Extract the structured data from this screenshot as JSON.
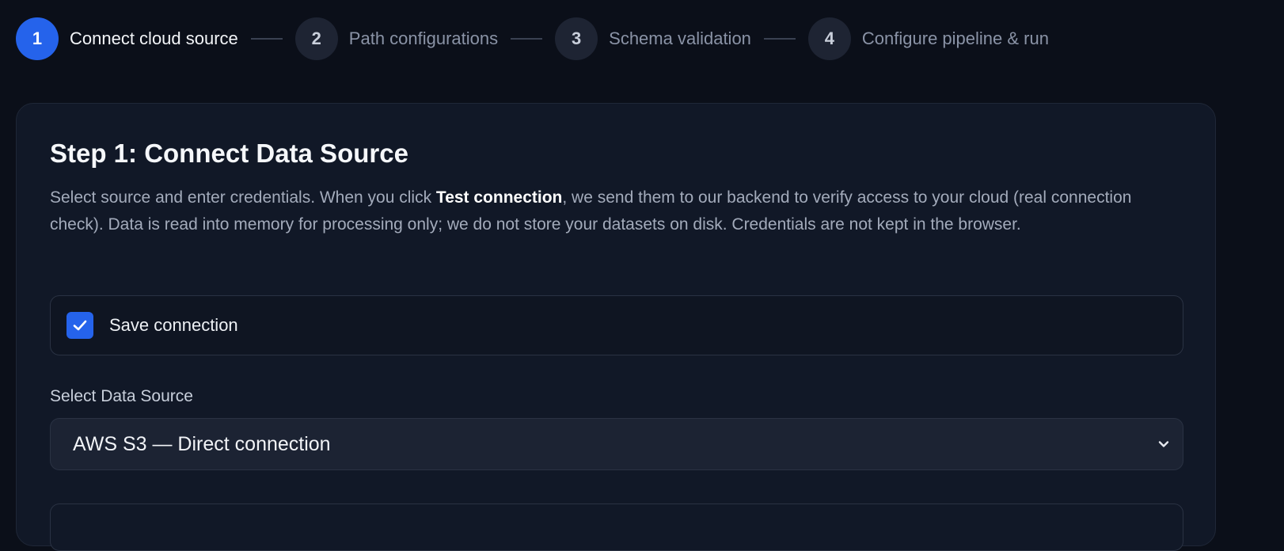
{
  "stepper": {
    "steps": [
      {
        "number": "1",
        "label": "Connect cloud source",
        "active": true
      },
      {
        "number": "2",
        "label": "Path configurations",
        "active": false
      },
      {
        "number": "3",
        "label": "Schema validation",
        "active": false
      },
      {
        "number": "4",
        "label": "Configure pipeline & run",
        "active": false
      }
    ]
  },
  "card": {
    "title": "Step 1: Connect Data Source",
    "description_pre": "Select source and enter credentials. When you click ",
    "description_bold": "Test connection",
    "description_post": ", we send them to our backend to verify access to your cloud (real connection check). Data is read into memory for processing only; we do not store your datasets on disk. Credentials are not kept in the browser."
  },
  "save_connection": {
    "label": "Save connection",
    "checked": true
  },
  "data_source": {
    "label": "Select Data Source",
    "selected": "AWS S3 — Direct connection"
  },
  "icons": {
    "checkbox": "check-icon",
    "select": "chevron-down-icon"
  },
  "colors": {
    "accent": "#2563eb",
    "background": "#0b0f19",
    "card": "#111827"
  }
}
